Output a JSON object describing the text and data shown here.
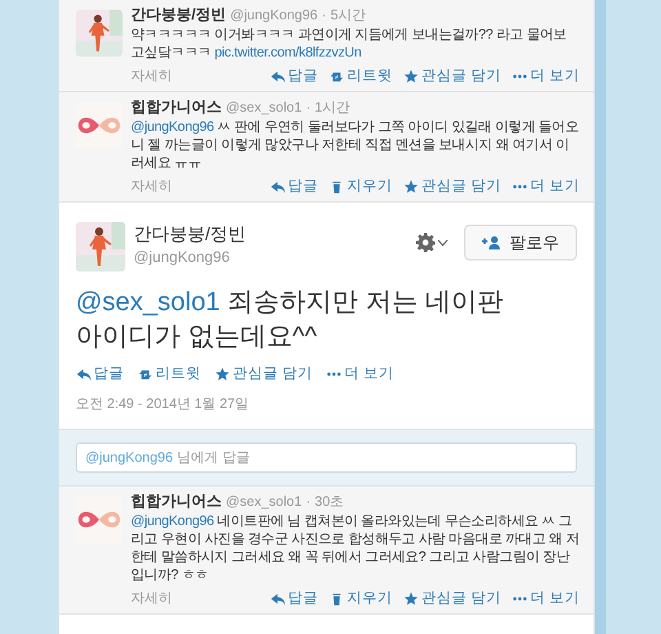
{
  "tweets_before": [
    {
      "name": "간다붕붕/정빈",
      "handle": "@jungKong96",
      "separator": "·",
      "time": "5시간",
      "segments": [
        {
          "kind": "text",
          "text": "약ㅋㅋㅋㅋㅋ 이거봐ㅋㅋㅋ 과연이게 지듬에게 보내는걸까?? 라고 물어보고싶닼ㅋㅋㅋ "
        },
        {
          "kind": "link",
          "text": "pic.twitter.com/k8lfzzvzUn"
        }
      ],
      "details": "자세히",
      "actions": [
        {
          "kind": "reply",
          "label": "답글"
        },
        {
          "kind": "retweet",
          "label": "리트윗"
        },
        {
          "kind": "favorite",
          "label": "관심글 담기"
        },
        {
          "kind": "more",
          "label": "더 보기"
        }
      ]
    },
    {
      "name": "힙합가니어스",
      "handle": "@sex_solo1",
      "separator": "·",
      "time": "1시간",
      "segments": [
        {
          "kind": "link",
          "text": "@jungKong96"
        },
        {
          "kind": "text",
          "text": " ㅆ 판에 우연히 둘러보다가 그쪽 아이디 있길래 이렇게 들어오니 젤 까는글이 이렇게 많았구나 저한테 직접 멘션을 보내시지 왜 여기서 이러세요 ㅠㅠ"
        }
      ],
      "details": "자세히",
      "actions": [
        {
          "kind": "reply",
          "label": "답글"
        },
        {
          "kind": "delete",
          "label": "지우기"
        },
        {
          "kind": "favorite",
          "label": "관심글 담기"
        },
        {
          "kind": "more",
          "label": "더 보기"
        }
      ]
    }
  ],
  "main_tweet": {
    "name": "간다붕붕/정빈",
    "handle": "@jungKong96",
    "follow_button": "팔로우",
    "segments": [
      {
        "kind": "link",
        "text": "@sex_solo1"
      },
      {
        "kind": "text",
        "text": " 죄송하지만 저는 네이판 아이디가 없는데요^^"
      }
    ],
    "actions": [
      {
        "kind": "reply",
        "label": "답글"
      },
      {
        "kind": "retweet",
        "label": "리트윗"
      },
      {
        "kind": "favorite",
        "label": "관심글 담기"
      },
      {
        "kind": "more",
        "label": "더 보기"
      }
    ],
    "timestamp": "오전 2:49 - 2014년 1월 27일"
  },
  "reply_box": {
    "mention": "@jungKong96",
    "placeholder": "님에게 답글"
  },
  "tweets_after": [
    {
      "name": "힙합가니어스",
      "handle": "@sex_solo1",
      "separator": "·",
      "time": "30초",
      "segments": [
        {
          "kind": "link",
          "text": "@jungKong96"
        },
        {
          "kind": "text",
          "text": " 네이트판에 님 캡쳐본이 올라와있는데 무슨소리하세요 ㅆ 그리고 우현이 사진을 경수군 사진으로 합성해두고 사람 마음대로 까대고 왜 저한테 말씀하시지 그러세요 왜 꼭 뒤에서 그러세요? 그리고 사람그림이 장난입니까? ㅎㅎ"
        }
      ],
      "details": "자세히",
      "actions": [
        {
          "kind": "reply",
          "label": "답글"
        },
        {
          "kind": "delete",
          "label": "지우기"
        },
        {
          "kind": "favorite",
          "label": "관심글 담기"
        },
        {
          "kind": "more",
          "label": "더 보기"
        }
      ]
    }
  ]
}
